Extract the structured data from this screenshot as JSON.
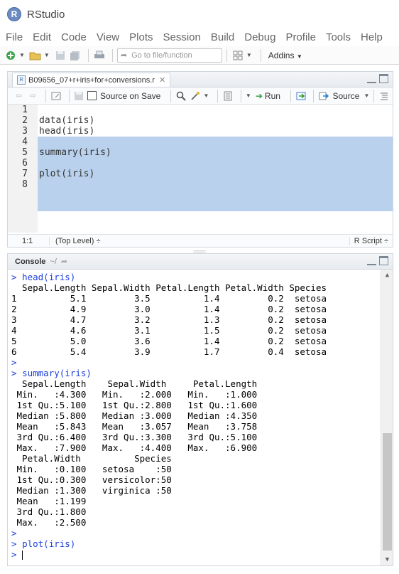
{
  "app": {
    "title": "RStudio",
    "logo_letter": "R"
  },
  "menu": [
    "File",
    "Edit",
    "Code",
    "View",
    "Plots",
    "Session",
    "Build",
    "Debug",
    "Profile",
    "Tools",
    "Help"
  ],
  "toolbar": {
    "goto_placeholder": "Go to file/function",
    "addins_label": "Addins"
  },
  "editor": {
    "tab_title": "B09656_07+r+iris+for+conversions.r",
    "source_on_save": "Source on Save",
    "run_label": "Run",
    "source_label": "Source",
    "lines": [
      {
        "n": "1",
        "text": ""
      },
      {
        "n": "2",
        "text": "data(iris)"
      },
      {
        "n": "3",
        "text": "head(iris)"
      },
      {
        "n": "4",
        "text": ""
      },
      {
        "n": "5",
        "text": "summary(iris)"
      },
      {
        "n": "6",
        "text": ""
      },
      {
        "n": "7",
        "text": "plot(iris)"
      },
      {
        "n": "8",
        "text": ""
      }
    ],
    "status": {
      "position": "1:1",
      "scope": "(Top Level) ÷",
      "file_type": "R Script ÷"
    }
  },
  "console": {
    "title": "Console",
    "working_dir": "~/",
    "lines": [
      {
        "p": "> ",
        "t": "head(iris)",
        "cmd": true
      },
      {
        "p": "",
        "t": "  Sepal.Length Sepal.Width Petal.Length Petal.Width Species"
      },
      {
        "p": "",
        "t": "1          5.1         3.5          1.4         0.2  setosa"
      },
      {
        "p": "",
        "t": "2          4.9         3.0          1.4         0.2  setosa"
      },
      {
        "p": "",
        "t": "3          4.7         3.2          1.3         0.2  setosa"
      },
      {
        "p": "",
        "t": "4          4.6         3.1          1.5         0.2  setosa"
      },
      {
        "p": "",
        "t": "5          5.0         3.6          1.4         0.2  setosa"
      },
      {
        "p": "",
        "t": "6          5.4         3.9          1.7         0.4  setosa"
      },
      {
        "p": "> ",
        "t": "",
        "cmd": true
      },
      {
        "p": "> ",
        "t": "summary(iris)",
        "cmd": true
      },
      {
        "p": "",
        "t": "  Sepal.Length    Sepal.Width     Petal.Length"
      },
      {
        "p": "",
        "t": " Min.   :4.300   Min.   :2.000   Min.   :1.000"
      },
      {
        "p": "",
        "t": " 1st Qu.:5.100   1st Qu.:2.800   1st Qu.:1.600"
      },
      {
        "p": "",
        "t": " Median :5.800   Median :3.000   Median :4.350"
      },
      {
        "p": "",
        "t": " Mean   :5.843   Mean   :3.057   Mean   :3.758"
      },
      {
        "p": "",
        "t": " 3rd Qu.:6.400   3rd Qu.:3.300   3rd Qu.:5.100"
      },
      {
        "p": "",
        "t": " Max.   :7.900   Max.   :4.400   Max.   :6.900"
      },
      {
        "p": "",
        "t": "  Petal.Width          Species"
      },
      {
        "p": "",
        "t": " Min.   :0.100   setosa    :50"
      },
      {
        "p": "",
        "t": " 1st Qu.:0.300   versicolor:50"
      },
      {
        "p": "",
        "t": " Median :1.300   virginica :50"
      },
      {
        "p": "",
        "t": " Mean   :1.199"
      },
      {
        "p": "",
        "t": " 3rd Qu.:1.800"
      },
      {
        "p": "",
        "t": " Max.   :2.500"
      },
      {
        "p": "> ",
        "t": "",
        "cmd": true
      },
      {
        "p": "> ",
        "t": "plot(iris)",
        "cmd": true
      },
      {
        "p": "> ",
        "t": "",
        "cmd": true,
        "cursor": true
      }
    ]
  },
  "colors": {
    "selection": "#b9d1ec",
    "prompt": "#1a3edb",
    "run_arrow": "#2a9a3a"
  },
  "icons": [
    "new-file-icon",
    "open-folder-icon",
    "save-icon",
    "save-all-icon",
    "print-icon",
    "goto-arrow-icon",
    "grid-icon",
    "back-icon",
    "forward-icon",
    "show-in-window-icon",
    "save-editor-icon",
    "search-icon",
    "magic-wand-icon",
    "compile-icon",
    "run-icon",
    "rerun-icon",
    "source-icon",
    "outline-icon",
    "refresh-icon"
  ]
}
